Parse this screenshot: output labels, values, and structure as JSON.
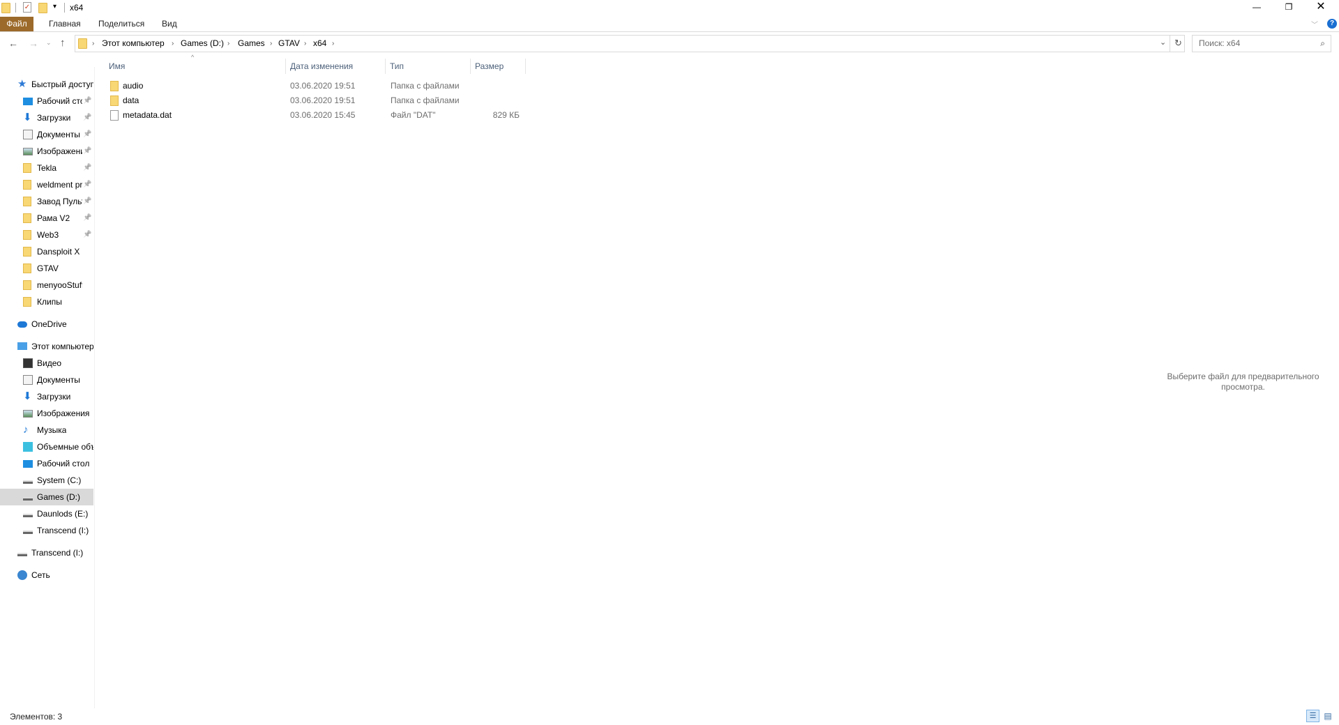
{
  "window": {
    "title": "x64"
  },
  "ribbon": {
    "tabs": [
      "Файл",
      "Главная",
      "Поделиться",
      "Вид"
    ],
    "accent": "#9c6a2a"
  },
  "address": {
    "crumbs": [
      "Этот компьютер",
      "Games (D:)",
      "Games",
      "GTAV",
      "x64"
    ]
  },
  "search": {
    "placeholder": "Поиск: x64"
  },
  "sidebar": {
    "quick_access": "Быстрый доступ",
    "pinned": [
      {
        "label": "Рабочий стол",
        "icon": "desktop-icon",
        "pinned": true
      },
      {
        "label": "Загрузки",
        "icon": "downloads-icon",
        "pinned": true
      },
      {
        "label": "Документы",
        "icon": "documents-icon",
        "pinned": true
      },
      {
        "label": "Изображения",
        "icon": "pictures-icon",
        "pinned": true
      },
      {
        "label": "Tekla",
        "icon": "folder-icon",
        "pinned": true
      },
      {
        "label": "weldment profiles",
        "icon": "folder-icon",
        "pinned": true
      },
      {
        "label": "Завод Пульт",
        "icon": "folder-icon",
        "pinned": true
      },
      {
        "label": "Рама V2",
        "icon": "folder-icon",
        "pinned": true
      },
      {
        "label": "Web3",
        "icon": "folder-icon",
        "pinned": true
      },
      {
        "label": "Dansploit X",
        "icon": "folder-icon",
        "pinned": false
      },
      {
        "label": "GTAV",
        "icon": "folder-icon",
        "pinned": false
      },
      {
        "label": "menyooStuff",
        "icon": "folder-icon",
        "pinned": false
      },
      {
        "label": "Клипы",
        "icon": "folder-icon",
        "pinned": false
      }
    ],
    "onedrive": "OneDrive",
    "this_pc": "Этот компьютер",
    "pc_items": [
      {
        "label": "Видео",
        "icon": "video-icon"
      },
      {
        "label": "Документы",
        "icon": "documents-icon"
      },
      {
        "label": "Загрузки",
        "icon": "downloads-icon"
      },
      {
        "label": "Изображения",
        "icon": "pictures-icon"
      },
      {
        "label": "Музыка",
        "icon": "music-icon"
      },
      {
        "label": "Объемные объекты",
        "icon": "3d-objects-icon"
      },
      {
        "label": "Рабочий стол",
        "icon": "desktop-icon"
      },
      {
        "label": "System (C:)",
        "icon": "drive-icon"
      },
      {
        "label": "Games (D:)",
        "icon": "drive-icon",
        "selected": true
      },
      {
        "label": "Daunlods (E:)",
        "icon": "drive-icon"
      },
      {
        "label": "Transcend (I:)",
        "icon": "drive-icon"
      }
    ],
    "transcend": "Transcend (I:)",
    "network": "Сеть"
  },
  "columns": [
    "Имя",
    "Дата изменения",
    "Тип",
    "Размер"
  ],
  "files": [
    {
      "name": "audio",
      "date": "03.06.2020 19:51",
      "type": "Папка с файлами",
      "size": "",
      "icon": "folder-icon"
    },
    {
      "name": "data",
      "date": "03.06.2020 19:51",
      "type": "Папка с файлами",
      "size": "",
      "icon": "folder-icon"
    },
    {
      "name": "metadata.dat",
      "date": "03.06.2020 15:45",
      "type": "Файл \"DAT\"",
      "size": "829 КБ",
      "icon": "file-icon"
    }
  ],
  "preview": {
    "text": "Выберите файл для предварительного просмотра."
  },
  "status": {
    "items": "Элементов: 3"
  }
}
